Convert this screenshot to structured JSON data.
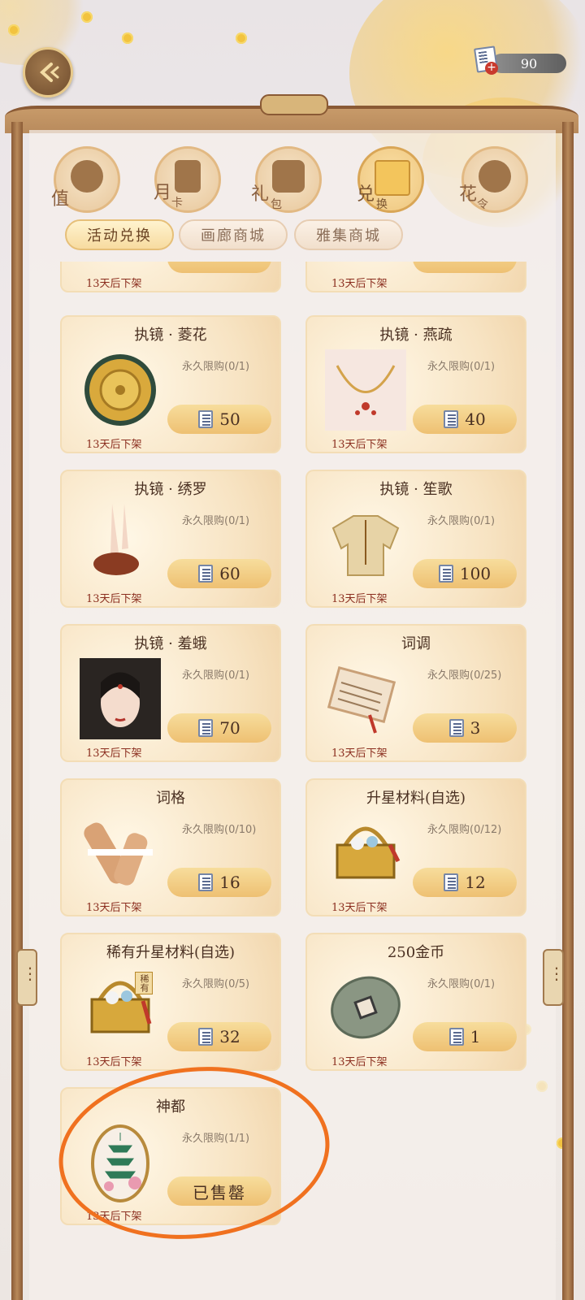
{
  "currency": {
    "amount": "90",
    "icon": "ticket-icon"
  },
  "categories": [
    {
      "chars": [
        "值"
      ],
      "icon": "coin-icon",
      "active": false
    },
    {
      "chars": [
        "月",
        "卡"
      ],
      "icon": "card-icon",
      "active": false
    },
    {
      "chars": [
        "礼",
        "包"
      ],
      "icon": "gift-pack-icon",
      "active": false
    },
    {
      "chars": [
        "兑",
        "换"
      ],
      "icon": "gift-box-icon",
      "active": true
    },
    {
      "chars": [
        "花",
        "令"
      ],
      "icon": "flower-scroll-icon",
      "active": false
    }
  ],
  "tabs": [
    "活动兑换",
    "画廊商城",
    "雅集商城"
  ],
  "partial_row": {
    "expire": "13天后下架"
  },
  "items": [
    {
      "title": "执镜 · 菱花",
      "limit": "永久限购(0/1)",
      "price": "50",
      "expire": "13天后下架",
      "pic": "mirror"
    },
    {
      "title": "执镜 · 燕疏",
      "limit": "永久限购(0/1)",
      "price": "40",
      "expire": "13天后下架",
      "pic": "necklace"
    },
    {
      "title": "执镜 · 绣罗",
      "limit": "永久限购(0/1)",
      "price": "60",
      "expire": "13天后下架",
      "pic": "shoe"
    },
    {
      "title": "执镜 · 笙歌",
      "limit": "永久限购(0/1)",
      "price": "100",
      "expire": "13天后下架",
      "pic": "top"
    },
    {
      "title": "执镜 · 羞蛾",
      "limit": "永久限购(0/1)",
      "price": "70",
      "expire": "13天后下架",
      "pic": "portrait"
    },
    {
      "title": "词调",
      "limit": "永久限购(0/25)",
      "price": "3",
      "expire": "13天后下架",
      "pic": "scroll"
    },
    {
      "title": "词格",
      "limit": "永久限购(0/10)",
      "price": "16",
      "expire": "13天后下架",
      "pic": "rolls"
    },
    {
      "title": "升星材料(自选)",
      "limit": "永久限购(0/12)",
      "price": "12",
      "expire": "13天后下架",
      "pic": "basket"
    },
    {
      "title": "稀有升星材料(自选)",
      "limit": "永久限购(0/5)",
      "price": "32",
      "expire": "13天后下架",
      "pic": "basket-rare",
      "rare_tag": "稀有"
    },
    {
      "title": "250金币",
      "limit": "永久限购(0/1)",
      "price": "1",
      "expire": "13天后下架",
      "pic": "coin"
    },
    {
      "title": "神都",
      "limit": "永久限购(1/1)",
      "price": "已售罄",
      "expire": "13天后下架",
      "pic": "pagoda",
      "sold_out": true
    }
  ],
  "colors": {
    "accent": "#eec072",
    "expire_text": "#8b2e1f",
    "annotation": "#f0711f"
  }
}
